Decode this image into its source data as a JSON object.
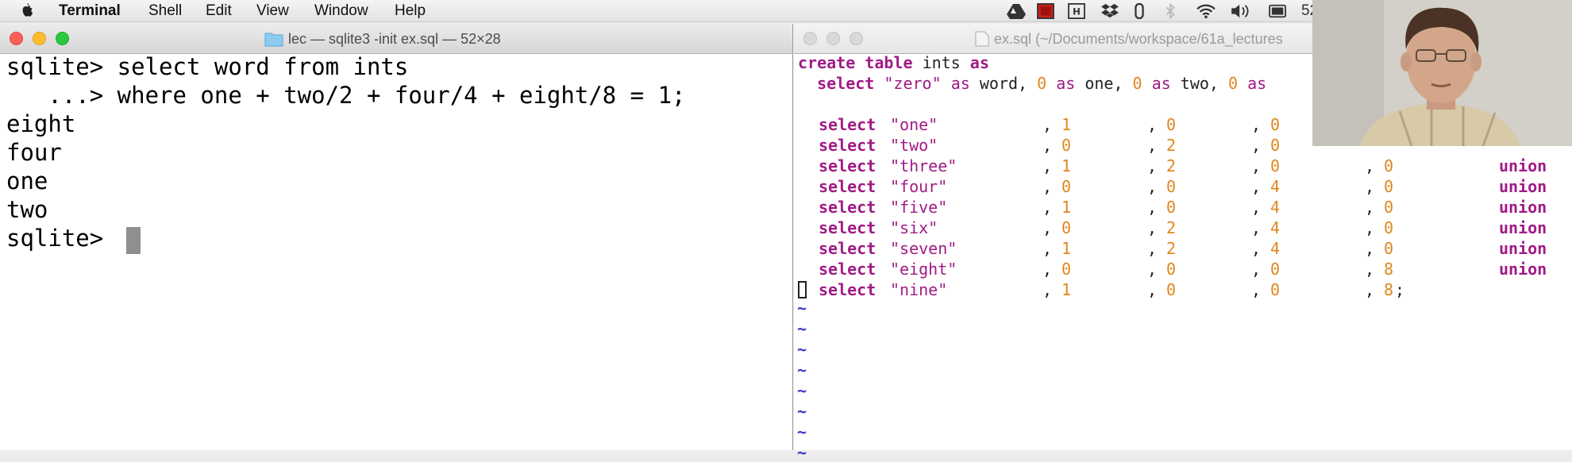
{
  "menubar": {
    "apple": "",
    "app": "Terminal",
    "items": [
      "Shell",
      "Edit",
      "View",
      "Window",
      "Help"
    ],
    "clock_fragment": "52"
  },
  "terminal": {
    "title": "lec — sqlite3 -init ex.sql — 52×28",
    "lines": [
      "sqlite> select word from ints",
      "   ...> where one + two/2 + four/4 + eight/8 = 1;",
      "eight",
      "four",
      "one",
      "two",
      "sqlite> "
    ]
  },
  "vim": {
    "title": "ex.sql (~/Documents/workspace/61a_lectures",
    "header": {
      "create": "create",
      "table": "table",
      "name": "ints",
      "as": "as"
    },
    "first_row": {
      "select": "select",
      "word": "\"zero\"",
      "as1": "as",
      "word_col": "word,",
      "v1": "0",
      "as2": "as",
      "one_col": "one,",
      "v2": "0",
      "as3": "as",
      "two_col": "two,",
      "v3": "0",
      "as4": "as"
    },
    "rows": [
      {
        "word": "\"one\"",
        "one": "1",
        "two": "0",
        "four": "0",
        "eight": "",
        "end": ""
      },
      {
        "word": "\"two\"",
        "one": "0",
        "two": "2",
        "four": "0",
        "eight": "",
        "end": ""
      },
      {
        "word": "\"three\"",
        "one": "1",
        "two": "2",
        "four": "0",
        "eight": "0",
        "end": "union"
      },
      {
        "word": "\"four\"",
        "one": "0",
        "two": "0",
        "four": "4",
        "eight": "0",
        "end": "union"
      },
      {
        "word": "\"five\"",
        "one": "1",
        "two": "0",
        "four": "4",
        "eight": "0",
        "end": "union"
      },
      {
        "word": "\"six\"",
        "one": "0",
        "two": "2",
        "four": "4",
        "eight": "0",
        "end": "union"
      },
      {
        "word": "\"seven\"",
        "one": "1",
        "two": "2",
        "four": "4",
        "eight": "0",
        "end": "union"
      },
      {
        "word": "\"eight\"",
        "one": "0",
        "two": "0",
        "four": "0",
        "eight": "8",
        "end": "union"
      },
      {
        "word": "\"nine\"",
        "one": "1",
        "two": "0",
        "four": "0",
        "eight": "8",
        "end": ";"
      }
    ],
    "select_kw": "select",
    "tilde": "~"
  },
  "colors": {
    "keyword": "#a11a86",
    "number": "#e0861c",
    "tilde": "#3838c8"
  }
}
